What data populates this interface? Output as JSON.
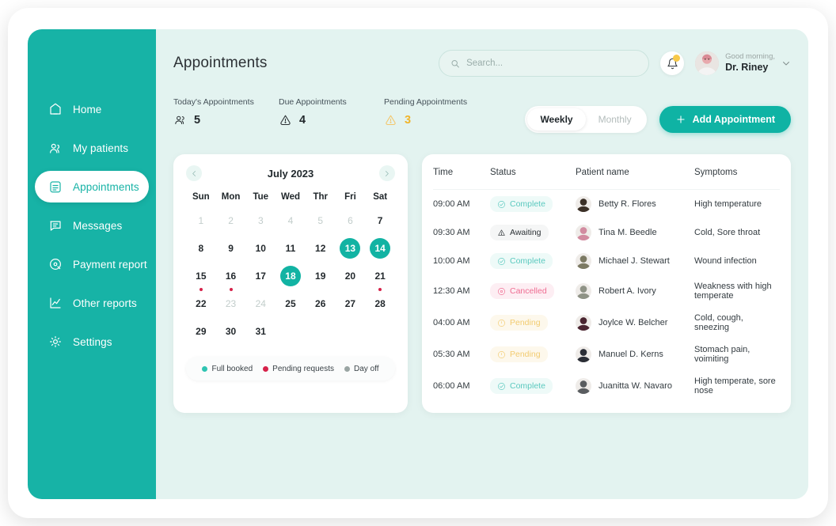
{
  "sidebar": {
    "items": [
      {
        "label": "Home",
        "icon": "home-icon",
        "active": false
      },
      {
        "label": "My patients",
        "icon": "patients-icon",
        "active": false
      },
      {
        "label": "Appointments",
        "icon": "calendar-icon",
        "active": true
      },
      {
        "label": "Messages",
        "icon": "message-icon",
        "active": false
      },
      {
        "label": "Payment report",
        "icon": "payment-icon",
        "active": false
      },
      {
        "label": "Other reports",
        "icon": "chart-icon",
        "active": false
      },
      {
        "label": "Settings",
        "icon": "gear-icon",
        "active": false
      }
    ]
  },
  "header": {
    "title": "Appointments",
    "search_placeholder": "Search...",
    "search_value": "",
    "greeting": "Good morning,",
    "doctor_name": "Dr. Riney",
    "has_notification": true
  },
  "stats": [
    {
      "label": "Today's Appointments",
      "value": "5",
      "icon": "group-icon",
      "highlight": false
    },
    {
      "label": "Due Appointments",
      "value": "4",
      "icon": "alert-icon",
      "highlight": false
    },
    {
      "label": "Pending Appointments",
      "value": "3",
      "icon": "alert-icon",
      "highlight": true
    }
  ],
  "view_toggle": {
    "options": [
      "Weekly",
      "Monthly"
    ],
    "selected": "Weekly"
  },
  "add_button": {
    "label": "Add Appointment"
  },
  "calendar": {
    "title": "July 2023",
    "prev_label": "‹",
    "next_label": "›",
    "weekdays": [
      "Sun",
      "Mon",
      "Tue",
      "Wed",
      "Thr",
      "Fri",
      "Sat"
    ],
    "days": [
      {
        "n": "1",
        "state": "muted"
      },
      {
        "n": "2",
        "state": "muted"
      },
      {
        "n": "3",
        "state": "muted"
      },
      {
        "n": "4",
        "state": "muted"
      },
      {
        "n": "5",
        "state": "muted"
      },
      {
        "n": "6",
        "state": "muted"
      },
      {
        "n": "7",
        "state": "normal"
      },
      {
        "n": "8",
        "state": "normal"
      },
      {
        "n": "9",
        "state": "normal"
      },
      {
        "n": "10",
        "state": "normal"
      },
      {
        "n": "11",
        "state": "normal"
      },
      {
        "n": "12",
        "state": "normal"
      },
      {
        "n": "13",
        "state": "selected"
      },
      {
        "n": "14",
        "state": "selected"
      },
      {
        "n": "15",
        "state": "normal",
        "dot": true
      },
      {
        "n": "16",
        "state": "normal",
        "dot": true
      },
      {
        "n": "17",
        "state": "normal"
      },
      {
        "n": "18",
        "state": "selected"
      },
      {
        "n": "19",
        "state": "normal"
      },
      {
        "n": "20",
        "state": "normal"
      },
      {
        "n": "21",
        "state": "normal",
        "dot": true
      },
      {
        "n": "22",
        "state": "normal"
      },
      {
        "n": "23",
        "state": "muted"
      },
      {
        "n": "24",
        "state": "muted"
      },
      {
        "n": "25",
        "state": "normal"
      },
      {
        "n": "26",
        "state": "normal"
      },
      {
        "n": "27",
        "state": "normal"
      },
      {
        "n": "28",
        "state": "normal"
      },
      {
        "n": "29",
        "state": "normal"
      },
      {
        "n": "30",
        "state": "normal"
      },
      {
        "n": "31",
        "state": "normal"
      }
    ],
    "legend": [
      {
        "label": "Full booked",
        "color": "#2fc4b2"
      },
      {
        "label": "Pending requests",
        "color": "#d6224a"
      },
      {
        "label": "Day off",
        "color": "#9aa5a3"
      }
    ]
  },
  "table": {
    "columns": [
      "Time",
      "Status",
      "Patient name",
      "Symptoms"
    ],
    "rows": [
      {
        "time": "09:00 AM",
        "status": "Complete",
        "status_kind": "complete",
        "name": "Betty R. Flores",
        "symptoms": "High temperature",
        "avatar": "#3b3027"
      },
      {
        "time": "09:30 AM",
        "status": "Awaiting",
        "status_kind": "awaiting",
        "name": "Tina M. Beedle",
        "symptoms": "Cold, Sore throat",
        "avatar": "#d28ba0"
      },
      {
        "time": "10:00 AM",
        "status": "Complete",
        "status_kind": "complete",
        "name": "Michael J. Stewart",
        "symptoms": "Wound infection",
        "avatar": "#7c7a63"
      },
      {
        "time": "12:30 AM",
        "status": "Cancelled",
        "status_kind": "cancelled",
        "name": "Robert A. Ivory",
        "symptoms": "Weakness with high temperate",
        "avatar": "#8f9386"
      },
      {
        "time": "04:00 AM",
        "status": "Pending",
        "status_kind": "pending",
        "name": "Joylce W. Belcher",
        "symptoms": "Cold, cough, sneezing",
        "avatar": "#4a2430"
      },
      {
        "time": "05:30 AM",
        "status": "Pending",
        "status_kind": "pending",
        "name": "Manuel D. Kerns",
        "symptoms": "Stomach pain, voimiting",
        "avatar": "#2b2e36"
      },
      {
        "time": "06:00 AM",
        "status": "Complete",
        "status_kind": "complete",
        "name": "Juanitta W. Navaro",
        "symptoms": "High temperate, sore nose",
        "avatar": "#5a5d60"
      }
    ]
  },
  "colors": {
    "brand": "#17b3a6",
    "accent": "#0fb3a4",
    "app_bg": "#e3f3f0",
    "pending": "#f0b429",
    "cancelled": "#ef6d92",
    "dot_red": "#d6224a"
  }
}
